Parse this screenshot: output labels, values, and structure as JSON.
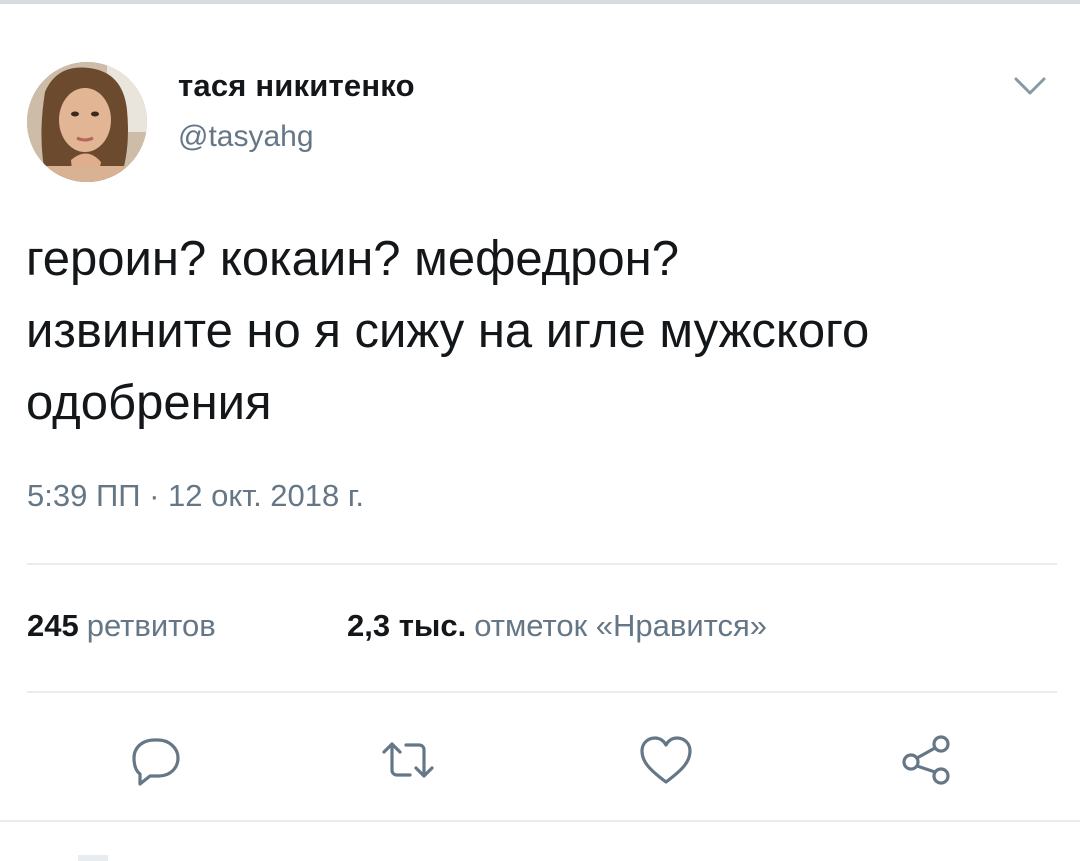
{
  "user": {
    "display_name": "тася никитенко",
    "handle": "@tasyahg",
    "avatar_icon": "profile-photo"
  },
  "menu": {
    "icon": "chevron-down-icon"
  },
  "tweet": {
    "lines": [
      "героин? кокаин? мефедрон?",
      "извините но я сижу на игле мужского",
      "одобрения"
    ],
    "timestamp": "5:39 ПП · 12 окт. 2018 г."
  },
  "stats": {
    "retweets_count": "245",
    "retweets_label": "ретвитов",
    "likes_count": "2,3 тыс.",
    "likes_label": "отметок «Нравится»"
  },
  "actions": [
    {
      "icon": "reply-icon"
    },
    {
      "icon": "retweet-icon"
    },
    {
      "icon": "like-heart-icon"
    },
    {
      "icon": "share-icon"
    }
  ],
  "colors": {
    "text_primary": "#14171a",
    "text_secondary": "#657786",
    "divider": "#e6ecf0",
    "icon": "#657786"
  }
}
